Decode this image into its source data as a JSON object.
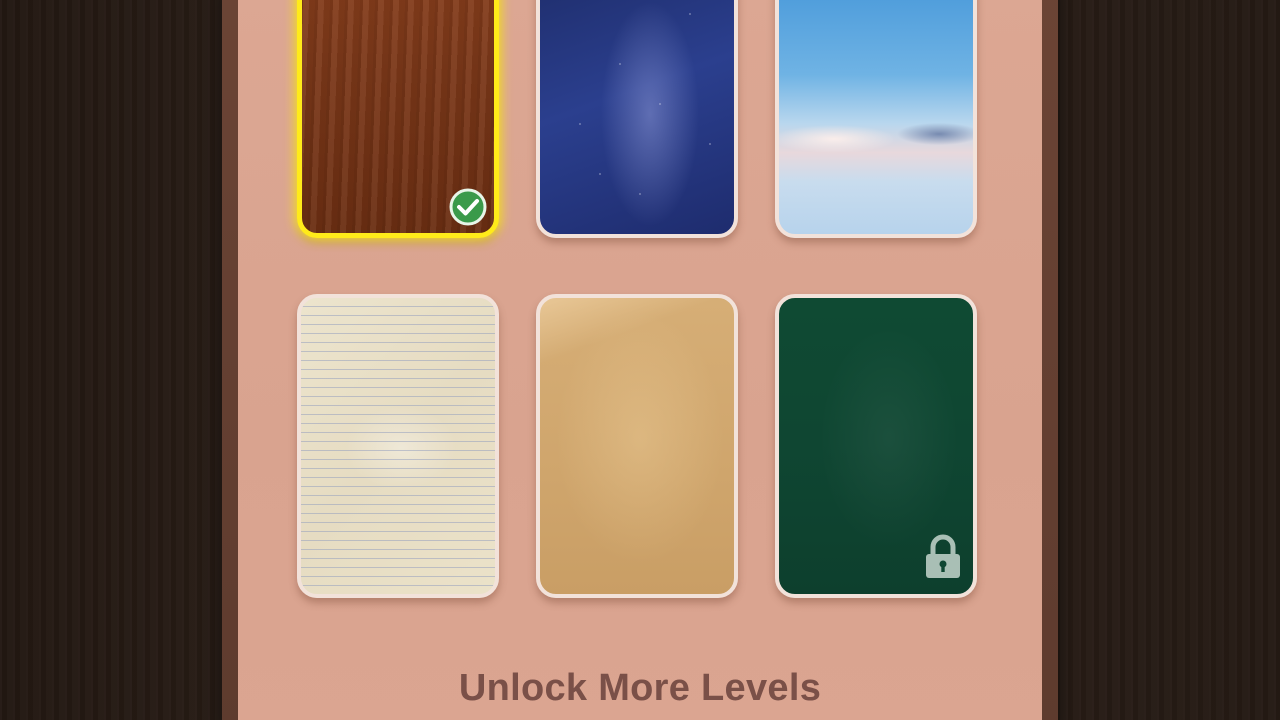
{
  "screen": {
    "title": "Unlock More Levels",
    "accent_color": "#ffeb1a",
    "text_color": "#7a5048"
  },
  "backgrounds": [
    {
      "name": "Wood",
      "state": "selected",
      "badge": "check-circle-icon"
    },
    {
      "name": "Night Sky",
      "state": "unlocked"
    },
    {
      "name": "Clouds",
      "state": "unlocked"
    },
    {
      "name": "Lined Paper",
      "state": "unlocked"
    },
    {
      "name": "Kraft Paper",
      "state": "unlocked"
    },
    {
      "name": "Chalkboard",
      "state": "locked",
      "badge": "lock-icon"
    }
  ]
}
